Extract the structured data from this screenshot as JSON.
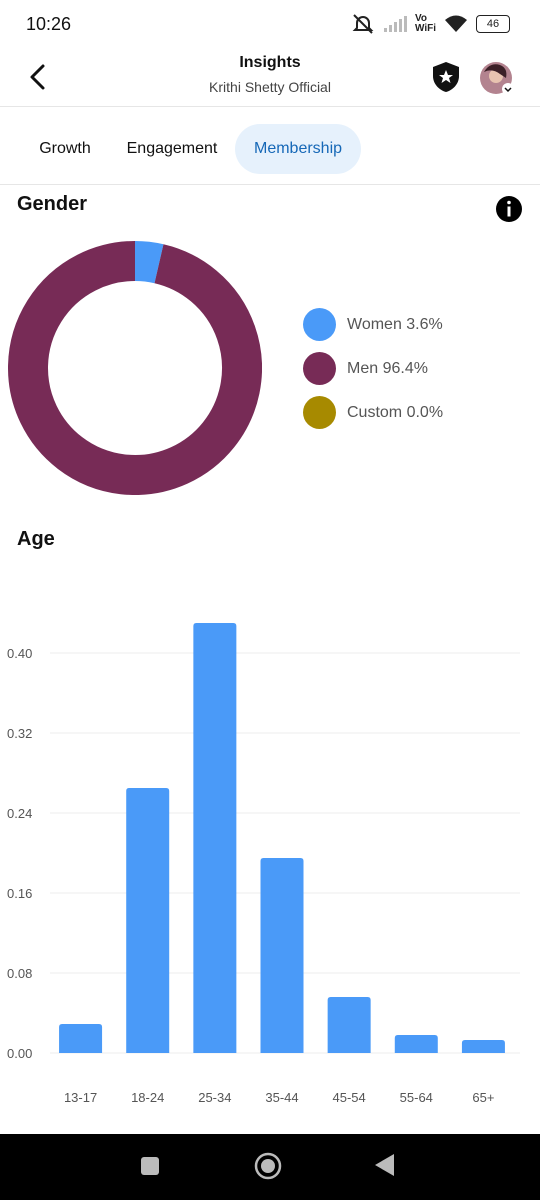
{
  "status": {
    "time": "10:26",
    "vo_top": "Vo",
    "vo_bottom": "WiFi",
    "battery": "46"
  },
  "header": {
    "title": "Insights",
    "subtitle": "Krithi Shetty Official"
  },
  "tabs": [
    {
      "label": "Growth",
      "active": false
    },
    {
      "label": "Engagement",
      "active": false
    },
    {
      "label": "Membership",
      "active": true
    }
  ],
  "gender": {
    "title": "Gender",
    "legend": [
      {
        "label": "Women 3.6%",
        "color": "#4a9af8"
      },
      {
        "label": "Men 96.4%",
        "color": "#772b56"
      },
      {
        "label": "Custom 0.0%",
        "color": "#a78a00"
      }
    ]
  },
  "age": {
    "title": "Age"
  },
  "colors": {
    "accent": "#1668b7",
    "bar": "#4a9af8",
    "men": "#772b56",
    "women": "#4a9af8",
    "custom": "#a78a00"
  },
  "chart_data": [
    {
      "type": "pie",
      "title": "Gender",
      "categories": [
        "Women",
        "Men",
        "Custom"
      ],
      "values": [
        3.6,
        96.4,
        0.0
      ]
    },
    {
      "type": "bar",
      "title": "Age",
      "categories": [
        "13-17",
        "18-24",
        "25-34",
        "35-44",
        "45-54",
        "55-64",
        "65+"
      ],
      "values": [
        0.029,
        0.265,
        0.43,
        0.195,
        0.056,
        0.018,
        0.013
      ],
      "y_ticks": [
        "0.00",
        "0.08",
        "0.16",
        "0.24",
        "0.32",
        "0.40"
      ],
      "ylim": [
        0,
        0.4
      ],
      "grid": true
    }
  ]
}
